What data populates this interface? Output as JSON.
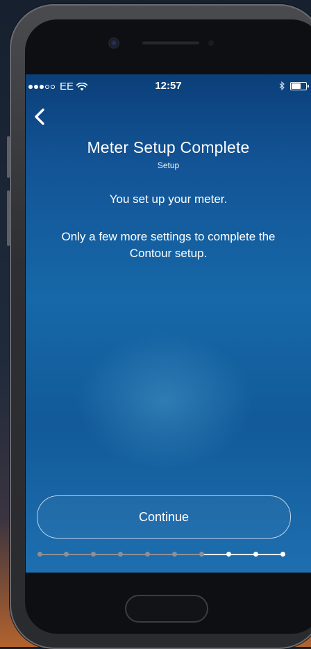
{
  "status_bar": {
    "carrier": "EE",
    "signal_bars_filled": 3,
    "signal_bars_total": 5,
    "time": "12:57",
    "battery_level": 0.7
  },
  "nav": {
    "back_icon": "chevron-left-icon"
  },
  "header": {
    "title": "Meter Setup Complete",
    "subtitle": "Setup"
  },
  "body": {
    "message": "You set up your meter.",
    "detail": "Only a few more settings to complete the Contour setup."
  },
  "actions": {
    "continue_label": "Continue"
  },
  "progress": {
    "total_steps": 10,
    "completed_steps": 7,
    "completed_color": "#8f8f95",
    "remaining_color": "#ffffff"
  },
  "colors": {
    "screen_background": "#1668a8",
    "text": "#ffffff"
  }
}
